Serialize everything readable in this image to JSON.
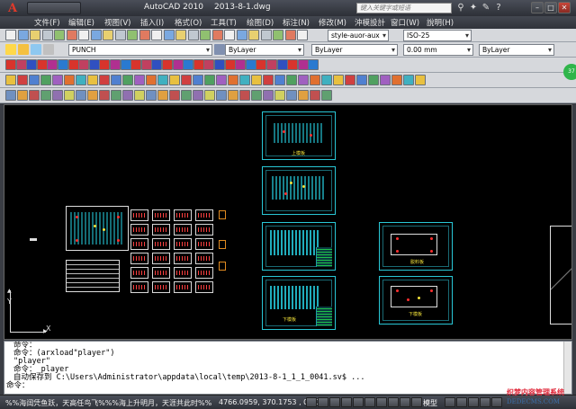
{
  "app": {
    "name": "AutoCAD 2010",
    "document": "2013-8-1.dwg",
    "search_placeholder": "键入关键字或短语"
  },
  "menu": [
    "文件(F)",
    "编辑(E)",
    "视图(V)",
    "插入(I)",
    "格式(O)",
    "工具(T)",
    "绘图(D)",
    "标注(N)",
    "修改(M)",
    "沖模設計",
    "窗口(W)",
    "說明(H)"
  ],
  "toolbar": {
    "layer_name": "PUNCH",
    "color": "ByLayer",
    "linetype": "ByLayer",
    "lineweight": "0.00 mm",
    "plotstyle": "ByLayer",
    "text_style": "style-auor-aux",
    "dim_style": "ISO-25"
  },
  "drawing": {
    "axis_y": "Y",
    "axis_x": "X",
    "sheet_labels": [
      "上模板",
      "下模板",
      "脱料板",
      "下模板",
      "固定板",
      "上模座"
    ]
  },
  "command_lines": [
    "命令：",
    "命令：(arxload\"player\")",
    "\"player\"",
    "命令：_player",
    "自动保存到 C:\\Users\\Administrator\\appdata\\local\\temp\\2013-8-1_1_1_0041.sv$ ...",
    "命令："
  ],
  "status": {
    "message": "%%海阔凭鱼跃，天高任鸟飞%%%海上升明月，天涯共此时%%",
    "coordinates": "4766.0959, 370.1753 , 0.0000",
    "model_label": "模型"
  },
  "badge": "37",
  "watermark": {
    "cn": "织梦内容管理系统",
    "en": "DEDECMS.COM"
  },
  "colors": {
    "drawing_bg": "#000000",
    "sheet_border": "#29c7d6",
    "accent_red": "#e03a2a"
  }
}
